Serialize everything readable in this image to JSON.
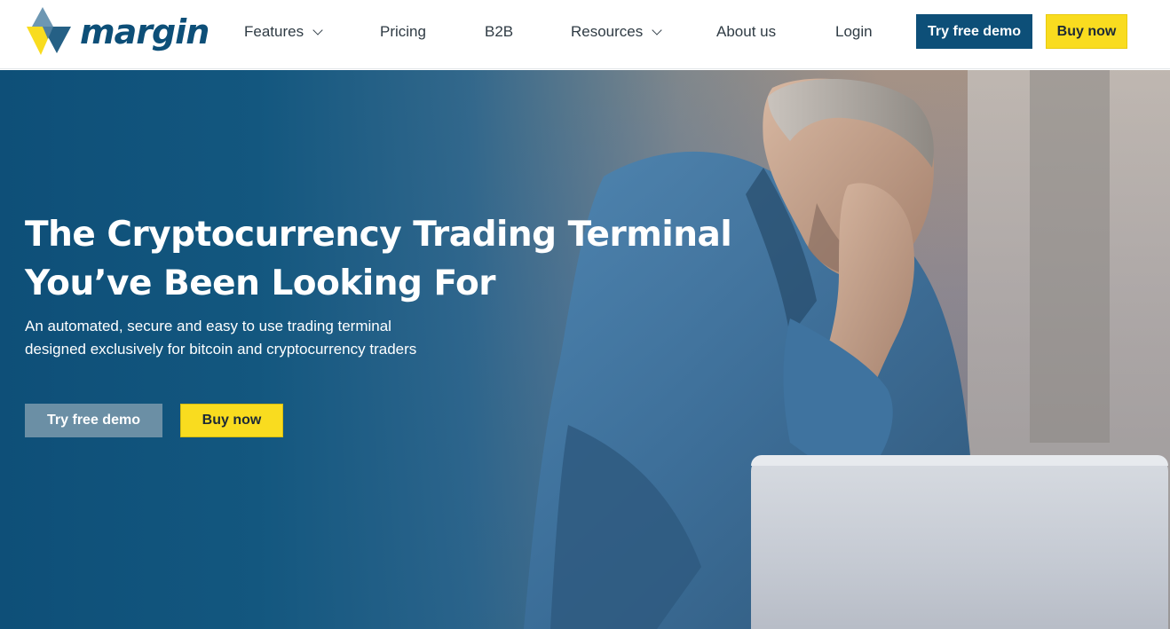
{
  "brand": {
    "name": "margin",
    "colors": {
      "primary": "#0d4f78",
      "accent": "#f9dc1f",
      "logo_light": "#6d97b3"
    }
  },
  "nav": {
    "items": [
      {
        "label": "Features",
        "has_dropdown": true,
        "icon": "chevron-down-icon"
      },
      {
        "label": "Pricing",
        "has_dropdown": false
      },
      {
        "label": "B2B",
        "has_dropdown": false
      },
      {
        "label": "Resources",
        "has_dropdown": true,
        "icon": "chevron-down-icon"
      },
      {
        "label": "About us",
        "has_dropdown": false
      },
      {
        "label": "Login",
        "has_dropdown": false
      }
    ],
    "demo_button": "Try free demo",
    "buy_button": "Buy now"
  },
  "hero": {
    "title_line1": "The Cryptocurrency Trading Terminal",
    "title_line2": "You’ve Been Looking For",
    "subtitle_line1": "An automated, secure and easy to use trading terminal",
    "subtitle_line2": "designed exclusively for bitcoin and cryptocurrency traders",
    "demo_button": "Try free demo",
    "buy_button": "Buy now"
  }
}
